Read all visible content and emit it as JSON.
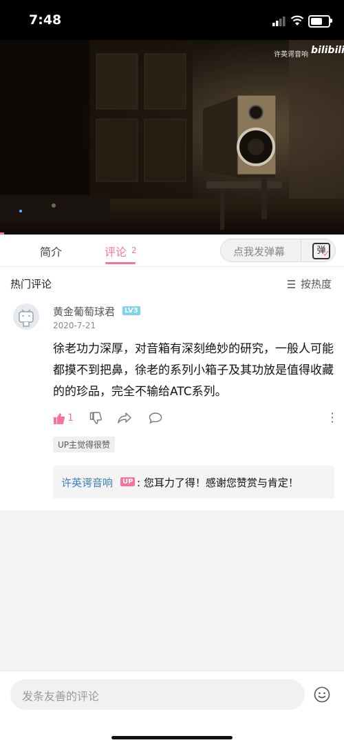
{
  "status_bar": {
    "time": "7:48"
  },
  "video": {
    "watermark": "许英谔音响",
    "brand": "bilibili",
    "progress_fraction": 0.012
  },
  "tabs": {
    "intro": "简介",
    "comments": "评论",
    "comments_count": "2"
  },
  "danmaku": {
    "placeholder": "点我发弹幕",
    "icon_label": "弹"
  },
  "comments_section": {
    "title": "热门评论",
    "sort_label": "按热度"
  },
  "comment": {
    "username": "黄金葡萄球君",
    "level": "LV3",
    "date": "2020-7-21",
    "text": "徐老功力深厚，对音箱有深刻绝妙的研究，一般人可能都摸不到把鼻，徐老的系列小箱子及其功放是值得收藏的的珍品，完全不输给ATC系列。",
    "likes": "1",
    "up_liked": "UP主觉得很赞",
    "reply": {
      "author": "许英谔音响",
      "badge": "UP",
      "text": ": 您耳力了得！感谢您赞赏与肯定！"
    }
  },
  "bottom": {
    "input_placeholder": "发条友善的评论"
  },
  "colors": {
    "accent": "#fb7299",
    "link": "#3a7fc4"
  }
}
